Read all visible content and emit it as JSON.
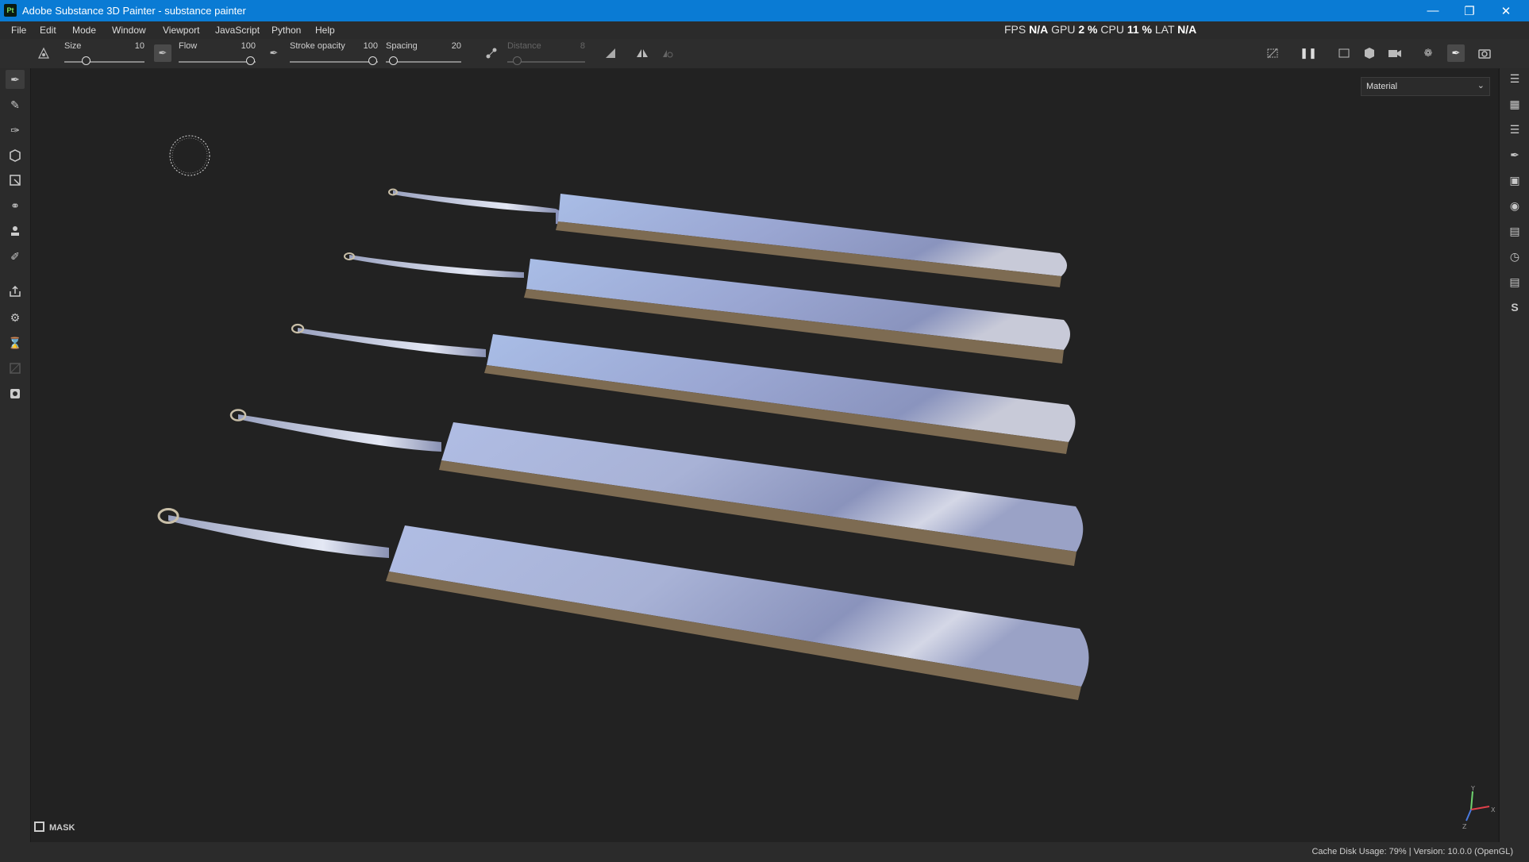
{
  "window": {
    "title": "Adobe Substance 3D Painter - substance painter",
    "app_badge": "Pt",
    "controls": [
      "minimize-icon",
      "restore-icon",
      "close-icon"
    ]
  },
  "menu": [
    "File",
    "Edit",
    "Mode",
    "Window",
    "Viewport",
    "JavaScript",
    "Python",
    "Help"
  ],
  "stats": {
    "fps_label": "FPS",
    "fps_value": "N/A",
    "gpu_label": "GPU",
    "gpu_value": "2 %",
    "cpu_label": "CPU",
    "cpu_value": "11 %",
    "lat_label": "LAT",
    "lat_value": "N/A"
  },
  "toolbar": {
    "size": {
      "label": "Size",
      "value": "10",
      "level": 0.25
    },
    "flow": {
      "label": "Flow",
      "value": "100",
      "level": 1.0
    },
    "stroke_opacity": {
      "label": "Stroke opacity",
      "value": "100",
      "level": 1.0
    },
    "spacing": {
      "label": "Spacing",
      "value": "20",
      "level": 0.05
    },
    "distance": {
      "label": "Distance",
      "value": "8",
      "level": 0.08
    }
  },
  "viewport": {
    "display_mode": "Material",
    "mask_label": "MASK",
    "axis_labels": {
      "x": "X",
      "y": "Y",
      "z": "Z"
    },
    "model_colors": {
      "metal_light": "#cdd6ee",
      "metal_dark": "#8f9ac0",
      "edge": "#7a6a55"
    }
  },
  "status": {
    "text": "Cache Disk Usage:    79% | Version: 10.0.0 (OpenGL)"
  },
  "left_tools": [
    "paint-brush-icon",
    "eraser-icon",
    "projection-icon",
    "polygon-fill-icon",
    "geometry-mask-icon",
    "smudge-icon",
    "clone-stamp-icon",
    "color-picker-icon",
    "export-icon",
    "bake-icon",
    "hourglass-icon",
    "disabled-tool-icon",
    "screenshot-tool-icon"
  ],
  "right_panels": [
    "layers-panel-icon",
    "texture-set-icon",
    "layer-stack-icon",
    "brush-properties-icon",
    "display-settings-icon",
    "shader-settings-icon",
    "assets-icon",
    "history-icon",
    "log-icon",
    "substance-icon"
  ]
}
